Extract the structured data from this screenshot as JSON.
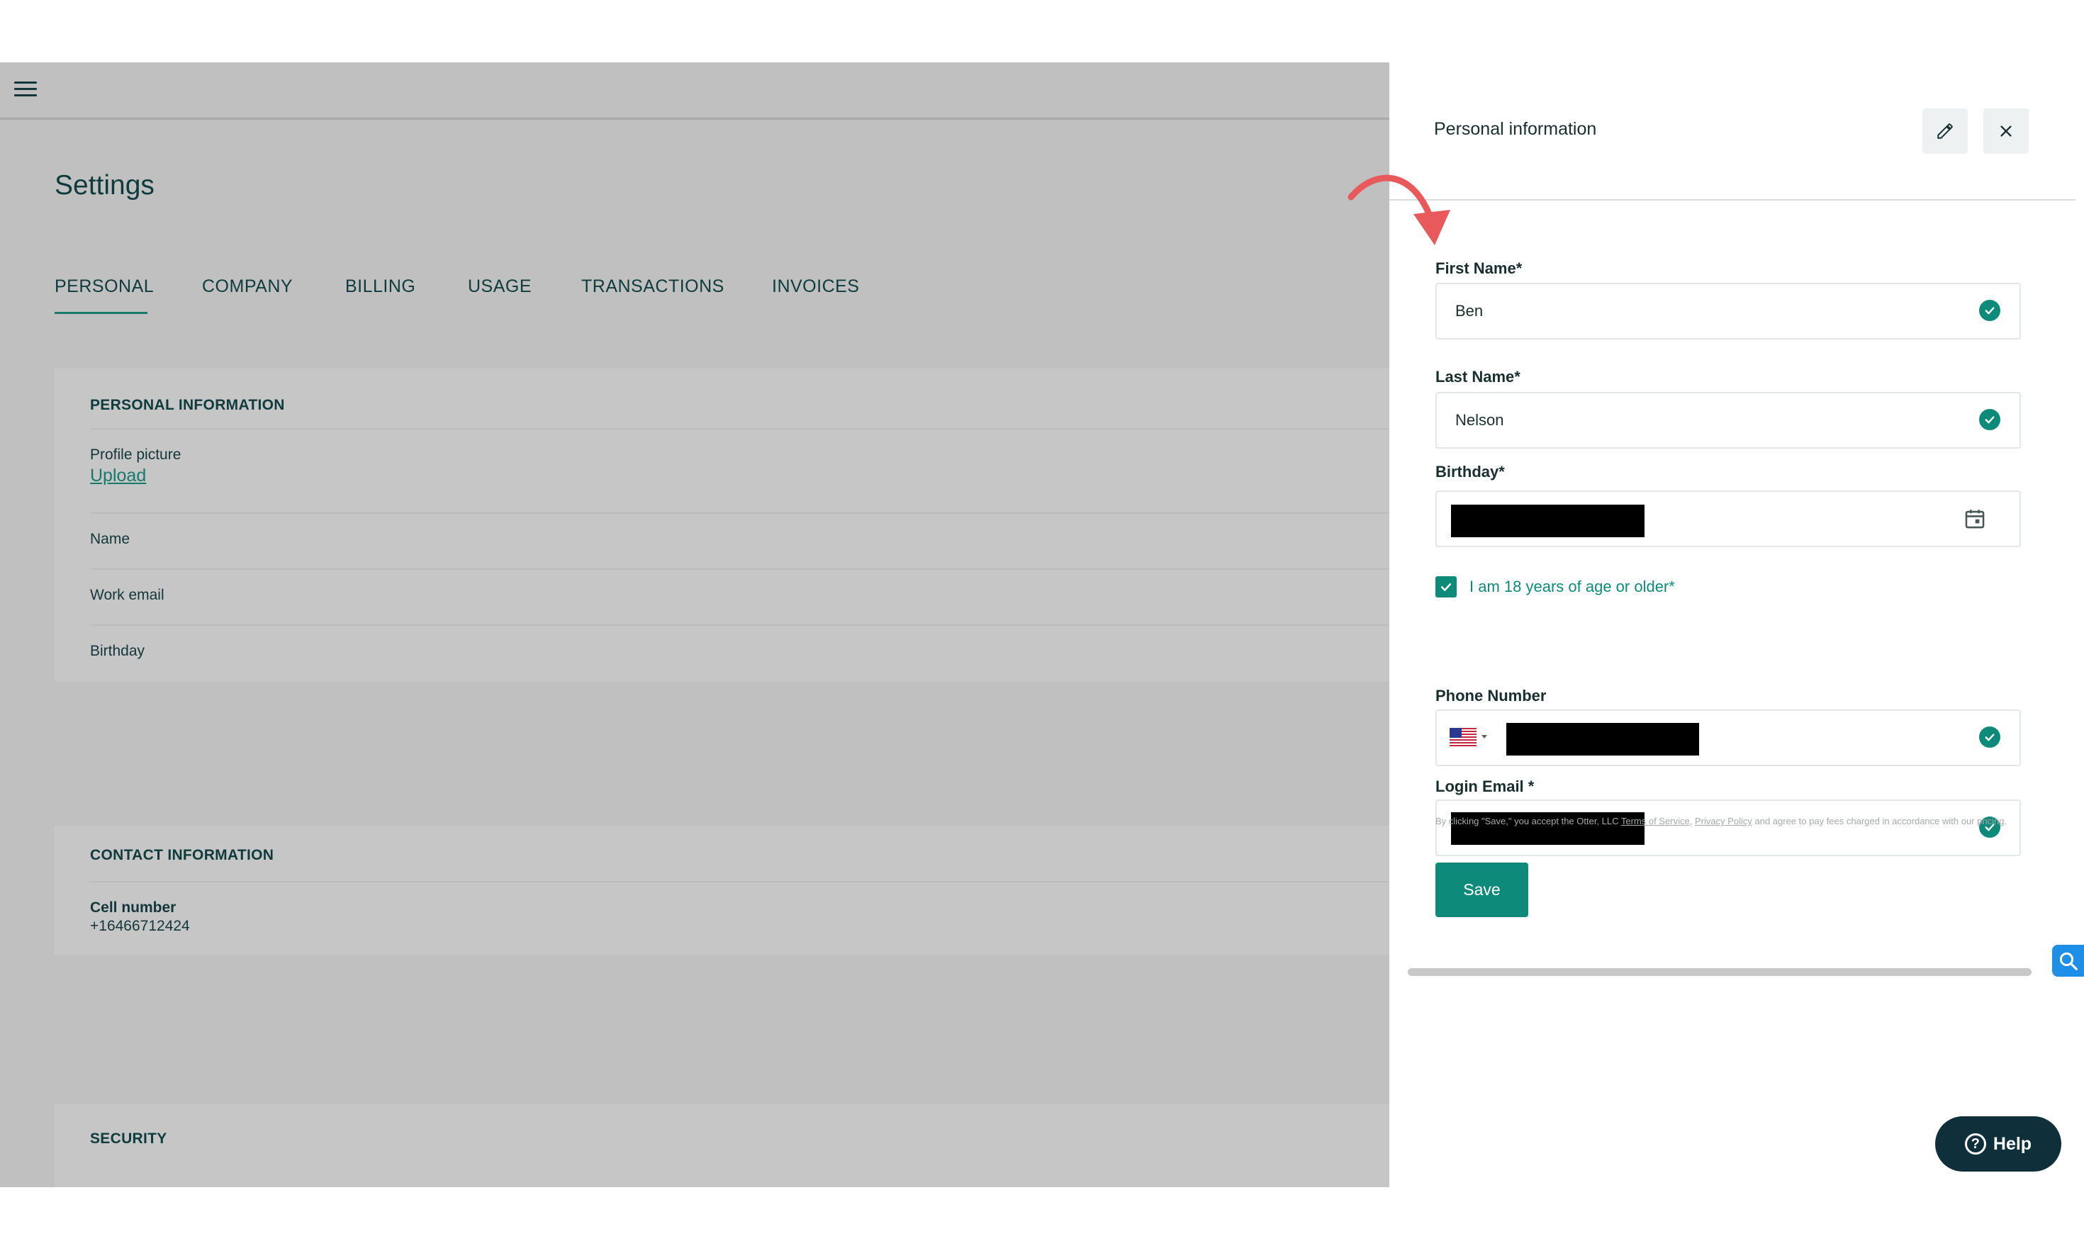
{
  "app": {
    "page_title": "Settings",
    "tabs": [
      {
        "label": "PERSONAL"
      },
      {
        "label": "COMPANY"
      },
      {
        "label": "BILLING"
      },
      {
        "label": "USAGE"
      },
      {
        "label": "TRANSACTIONS"
      },
      {
        "label": "INVOICES"
      }
    ],
    "personal_info": {
      "heading": "PERSONAL INFORMATION",
      "profile_picture_label": "Profile picture",
      "upload_link": "Upload",
      "rows": [
        "Name",
        "Work email",
        "Birthday"
      ]
    },
    "contact_info": {
      "heading": "CONTACT INFORMATION",
      "cell_label": "Cell number",
      "cell_value": "+16466712424"
    },
    "security": {
      "heading": "SECURITY"
    }
  },
  "panel": {
    "title": "Personal information",
    "first_name": {
      "label": "First Name*",
      "value": "Ben"
    },
    "last_name": {
      "label": "Last Name*",
      "value": "Nelson"
    },
    "birthday": {
      "label": "Birthday*"
    },
    "age_checkbox": {
      "label": "I am 18 years of age or older*",
      "checked": true
    },
    "phone": {
      "label": "Phone Number",
      "country": "US"
    },
    "login_email": {
      "label": "Login Email *"
    },
    "terms": {
      "prefix": "By clicking \"Save,\" you accept the Otter, LLC ",
      "terms_link": "Terms of Service",
      "sep": ", ",
      "privacy_link": "Privacy Policy",
      "suffix": " and agree to pay fees charged in accordance with our pricing."
    },
    "save_label": "Save"
  },
  "help": {
    "label": "Help"
  },
  "colors": {
    "accent": "#0e8a7b",
    "overlay": "#c0c0c0",
    "dark": "#0f2f3b",
    "annotation_arrow": "#e8595c"
  },
  "icons": [
    "menu-icon",
    "pencil-icon",
    "close-icon",
    "check-circle-icon",
    "calendar-icon",
    "us-flag-icon",
    "help-icon",
    "search-tool-icon",
    "curved-arrow-icon"
  ]
}
